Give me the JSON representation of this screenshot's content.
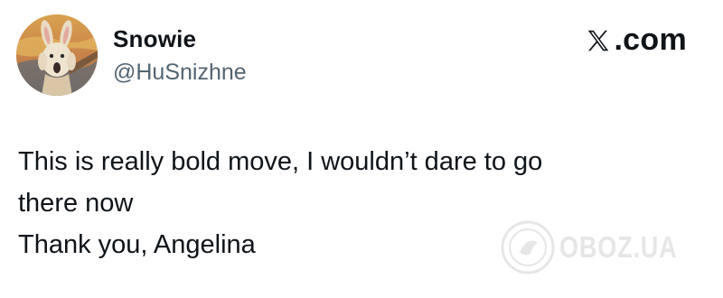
{
  "tweet": {
    "author": {
      "display_name": "Snowie",
      "handle": "@HuSnizhne",
      "avatar_icon": "scream-bunny-avatar"
    },
    "source": {
      "logo_icon": "x-logo-icon",
      "label": ".com"
    },
    "text_lines": [
      "This is really bold move, I wouldn’t dare to go",
      "there now",
      "Thank you, Angelina"
    ]
  },
  "watermark": {
    "icon": "oboz-logo-icon",
    "text": "OBOZ.UA"
  },
  "colors": {
    "background": "#ffffff",
    "text_primary": "#0f1419",
    "text_secondary": "#536471"
  }
}
